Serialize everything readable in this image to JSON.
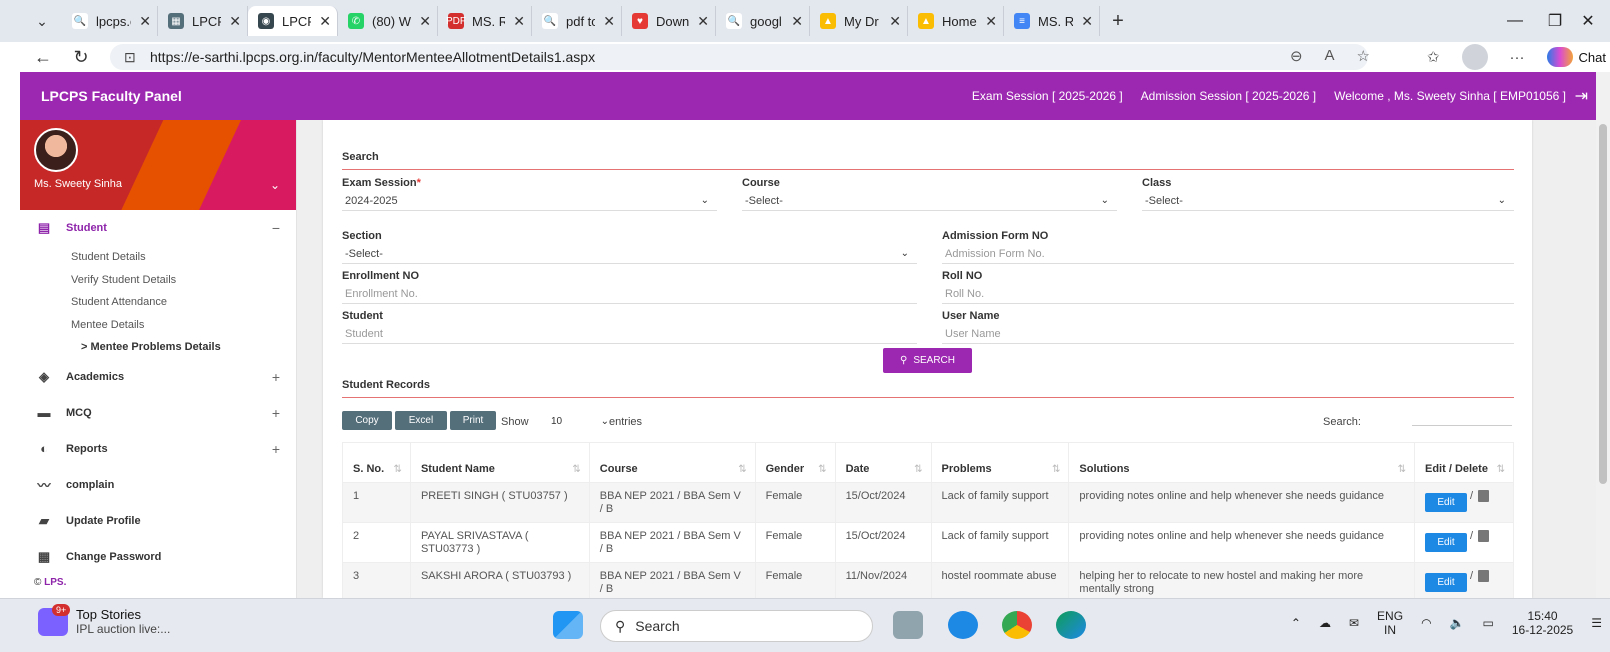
{
  "browser": {
    "tabs": [
      {
        "label": "lpcps.c",
        "fav": "#fff",
        "favtext": "🔍",
        "color": "#1a73e8"
      },
      {
        "label": "LPCPS",
        "fav": "#546e7a",
        "favtext": "▦"
      },
      {
        "label": "LPCPS",
        "fav": "#37474f",
        "favtext": "◉",
        "active": true
      },
      {
        "label": "(80) W",
        "fav": "#25d366",
        "favtext": "✆"
      },
      {
        "label": "MS. R.",
        "fav": "#d32f2f",
        "favtext": "PDF"
      },
      {
        "label": "pdf to",
        "fav": "#fff",
        "favtext": "🔍",
        "color": "#1a73e8"
      },
      {
        "label": "Downl",
        "fav": "#e53935",
        "favtext": "♥"
      },
      {
        "label": "googl",
        "fav": "#fff",
        "favtext": "🔍",
        "color": "#1a73e8"
      },
      {
        "label": "My Dr",
        "fav": "#fbbc04",
        "favtext": "▲"
      },
      {
        "label": "Home",
        "fav": "#fbbc04",
        "favtext": "▲"
      },
      {
        "label": "MS. R.",
        "fav": "#4285f4",
        "favtext": "≡"
      }
    ],
    "url": "https://e-sarthi.lpcps.org.in/faculty/MentorMenteeAllotmentDetails1.aspx",
    "copilot_label": "Chat"
  },
  "header": {
    "brand": "LPCPS Faculty Panel",
    "exam_session": "Exam Session [ 2025-2026 ]",
    "admission_session": "Admission Session [ 2025-2026 ]",
    "welcome": "Welcome , Ms. Sweety Sinha [ EMP01056 ]"
  },
  "sidebar": {
    "user_name": "Ms. Sweety Sinha",
    "menu": [
      {
        "label": "Student",
        "icon": "clipboard-icon",
        "glyph": "▤",
        "toggle": "−",
        "open": true
      },
      {
        "label": "Academics",
        "icon": "layers-icon",
        "glyph": "◈",
        "toggle": "+"
      },
      {
        "label": "MCQ",
        "icon": "screen-icon",
        "glyph": "▬",
        "toggle": "+"
      },
      {
        "label": "Reports",
        "icon": "pie-chart-icon",
        "glyph": "◐",
        "toggle": "+"
      },
      {
        "label": "complain",
        "icon": "trend-icon",
        "glyph": "〰",
        "toggle": ""
      },
      {
        "label": "Update Profile",
        "icon": "folder-icon",
        "glyph": "▰",
        "toggle": ""
      },
      {
        "label": "Change Password",
        "icon": "grid-icon",
        "glyph": "▦",
        "toggle": ""
      }
    ],
    "student_sub": [
      "Student Details",
      "Verify Student Details",
      "Student Attendance",
      "Mentee Details",
      "> Mentee Problems Details"
    ],
    "copyright_prefix": "© ",
    "copyright_brand": "LPS."
  },
  "search": {
    "title": "Search",
    "exam_session_label": "Exam Session",
    "required_mark": "*",
    "exam_session_value": "2024-2025",
    "course_label": "Course",
    "course_value": "-Select-",
    "class_label": "Class",
    "class_value": "-Select-",
    "section_label": "Section",
    "section_value": "-Select-",
    "admission_label": "Admission Form NO",
    "admission_placeholder": "Admission Form No.",
    "enrollment_label": "Enrollment NO",
    "enrollment_placeholder": "Enrollment No.",
    "roll_label": "Roll NO",
    "roll_placeholder": "Roll No.",
    "student_label": "Student",
    "student_placeholder": "Student",
    "username_label": "User Name",
    "username_placeholder": "User Name",
    "button": "SEARCH"
  },
  "records": {
    "title": "Student Records",
    "buttons": {
      "copy": "Copy",
      "excel": "Excel",
      "print": "Print"
    },
    "show": "Show",
    "entries_value": "10",
    "entries": "entries",
    "search_label": "Search:",
    "columns": [
      "S. No.",
      "Student Name",
      "Course",
      "Gender",
      "Date",
      "Problems",
      "Solutions",
      "Edit / Delete"
    ],
    "rows": [
      {
        "sno": "1",
        "name": "PREETI SINGH ( STU03757 )",
        "course": "BBA NEP 2021 / BBA Sem V / B",
        "gender": "Female",
        "date": "15/Oct/2024",
        "problem": "Lack of family support",
        "solution": "providing notes online and help whenever she needs guidance"
      },
      {
        "sno": "2",
        "name": "PAYAL SRIVASTAVA ( STU03773 )",
        "course": "BBA NEP 2021 / BBA Sem V / B",
        "gender": "Female",
        "date": "15/Oct/2024",
        "problem": "Lack of family support",
        "solution": "providing notes online and help whenever she needs guidance"
      },
      {
        "sno": "3",
        "name": "SAKSHI ARORA ( STU03793 )",
        "course": "BBA NEP 2021 / BBA Sem V / B",
        "gender": "Female",
        "date": "11/Nov/2024",
        "problem": "hostel roommate abuse",
        "solution": "helping her to relocate to new hostel and making her more mentally strong"
      }
    ],
    "edit_label": "Edit",
    "separator": "/"
  },
  "taskbar": {
    "news_badge": "9+",
    "news_title": "Top Stories",
    "news_sub": "IPL auction live:...",
    "search": "Search",
    "lang_top": "ENG",
    "lang_bottom": "IN",
    "time": "15:40",
    "date": "16-12-2025"
  }
}
